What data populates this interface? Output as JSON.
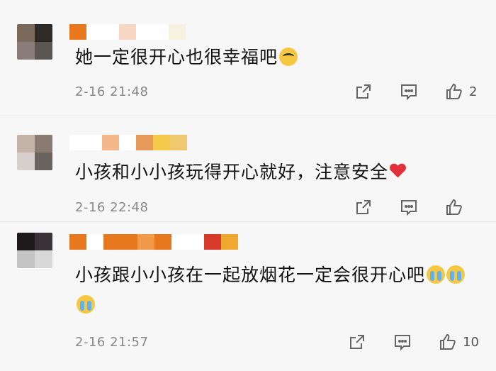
{
  "comments": [
    {
      "text": "她一定很开心也很幸福吧",
      "emoji": "pleading-face-emoji",
      "time": "2-16 21:48",
      "likes": "2",
      "avatar_colors": [
        "#7a6a5c",
        "#2e2a28",
        "#8a7c78",
        "#5a5654"
      ],
      "name_colors": [
        "#e8781e",
        "#ffffff",
        "#f7d8c4",
        "#ffffff",
        "#f5f2e0"
      ]
    },
    {
      "text": "小孩和小小孩玩得开心就好，注意安全",
      "emoji": "red-heart-emoji",
      "time": "2-16 22:48",
      "likes": "",
      "avatar_colors": [
        "#c4b4a8",
        "#8a7c72",
        "#d8d0cc",
        "#6a6460"
      ],
      "name_colors": [
        "#f5b88a",
        "#ffffff",
        "#e89a5a",
        "#f4c84a",
        "#f0c870"
      ]
    },
    {
      "text": "小孩跟小小孩在一起放烟花一定会很开心吧",
      "emoji": "loudly-crying-face-emoji",
      "time": "2-16 21:57",
      "likes": "10",
      "avatar_colors": [
        "#1e1a1c",
        "#3a3438",
        "#c4c4c4",
        "#d8d8d8"
      ],
      "name_colors": [
        "#e8781e",
        "#f09a4a",
        "#e8781e",
        "#d63a2a",
        "#f0a830"
      ]
    }
  ],
  "icons": {
    "share": "share-icon",
    "comment": "comment-icon",
    "like": "thumbs-up-icon"
  }
}
